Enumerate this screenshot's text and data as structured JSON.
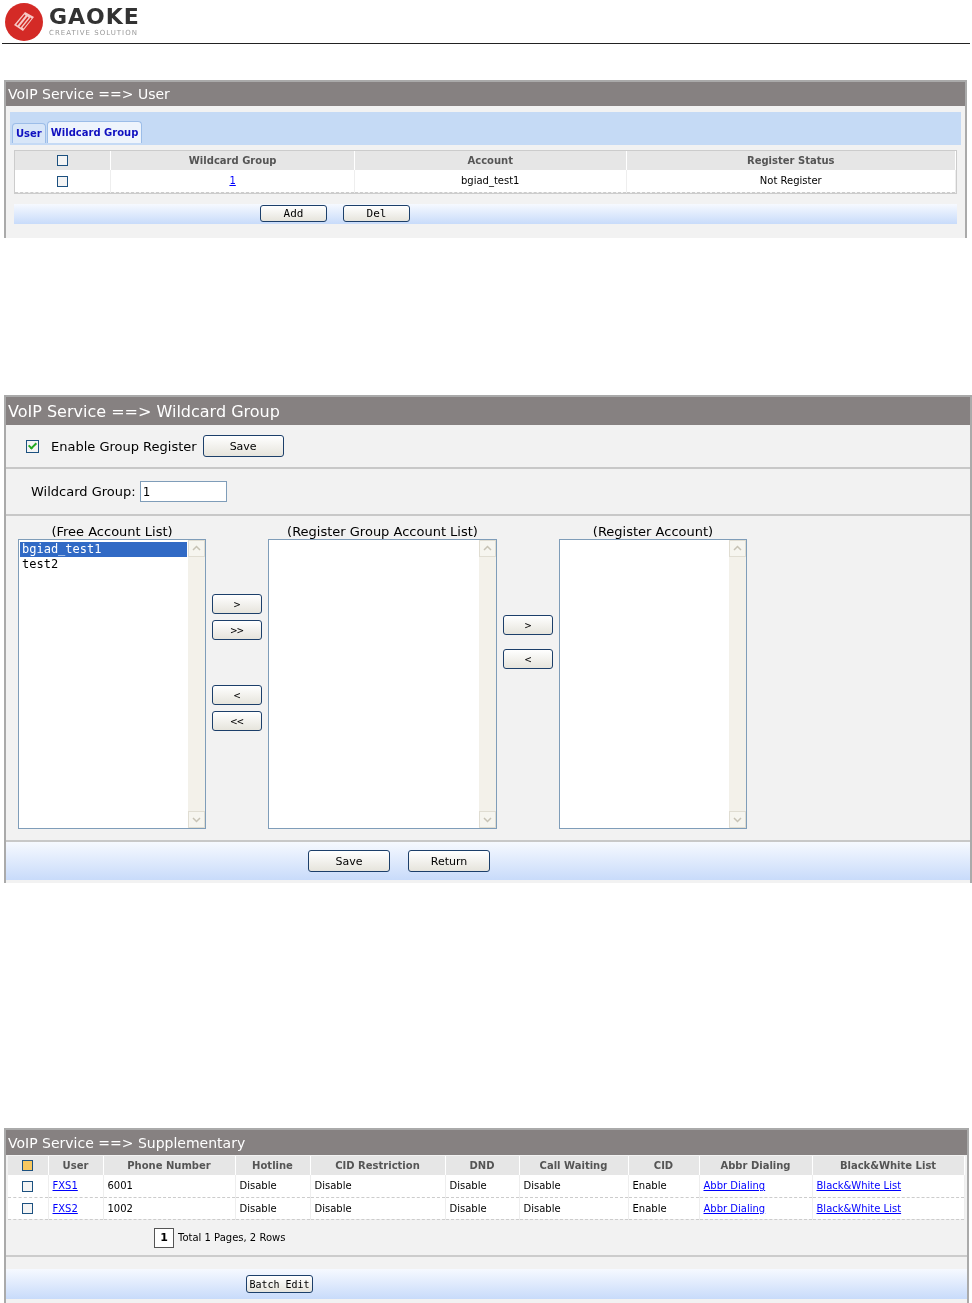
{
  "header": {
    "logo_text": "GAOKE",
    "tagline": "CREATIVE SOLUTION"
  },
  "user_panel": {
    "title": "VoIP Service ==> User",
    "tabs": [
      {
        "label": "User",
        "selected": false
      },
      {
        "label": "Wildcard Group",
        "selected": true
      }
    ],
    "table": {
      "select_all": {
        "checked": false
      },
      "columns": [
        "Wildcard Group",
        "Account",
        "Register Status"
      ],
      "rows": [
        {
          "checked": false,
          "wildcard_group": "1",
          "account": "bgiad_test1",
          "register_status": "Not Register"
        }
      ]
    },
    "buttons": [
      "Add",
      "Del"
    ]
  },
  "wildcard_panel": {
    "title": "VoIP Service ==> Wildcard Group",
    "enable_group_register": {
      "label": "Enable Group Register",
      "checked": true
    },
    "save_button": "Save",
    "wildcard_group": {
      "label": "Wildcard Group:",
      "value": "1"
    },
    "free_list": {
      "label": "(Free Account List)",
      "items": [
        {
          "text": "bgiad_test1",
          "selected": true
        },
        {
          "text": "test2",
          "selected": false
        }
      ]
    },
    "move_buttons_1": [
      ">",
      ">>",
      "<",
      "<<"
    ],
    "register_group_list": {
      "label": "(Register Group Account List)"
    },
    "move_buttons_2": [
      ">",
      "<"
    ],
    "register_account_list": {
      "label": "(Register Account)"
    },
    "buttons": [
      "Save",
      "Return"
    ]
  },
  "supplementary_panel": {
    "title": "VoIP Service ==> Supplementary",
    "select_all": {
      "checked": false,
      "highlighted": true
    },
    "columns": [
      "User",
      "Phone Number",
      "Hotline",
      "CID Restriction",
      "DND",
      "Call Waiting",
      "CID",
      "Abbr Dialing",
      "Black&White List"
    ],
    "rows": [
      {
        "checked": false,
        "user": "FXS1",
        "phone": "6001",
        "hotline": "Disable",
        "cid_restriction": "Disable",
        "dnd": "Disable",
        "call_waiting": "Disable",
        "cid": "Enable",
        "abbr": "Abbr Dialing",
        "bw": "Black&White List"
      },
      {
        "checked": false,
        "user": "FXS2",
        "phone": "1002",
        "hotline": "Disable",
        "cid_restriction": "Disable",
        "dnd": "Disable",
        "call_waiting": "Disable",
        "cid": "Enable",
        "abbr": "Abbr Dialing",
        "bw": "Black&White List"
      }
    ],
    "pager": {
      "page": "1",
      "summary": "Total 1 Pages, 2 Rows"
    },
    "batch_button": "Batch Edit"
  }
}
